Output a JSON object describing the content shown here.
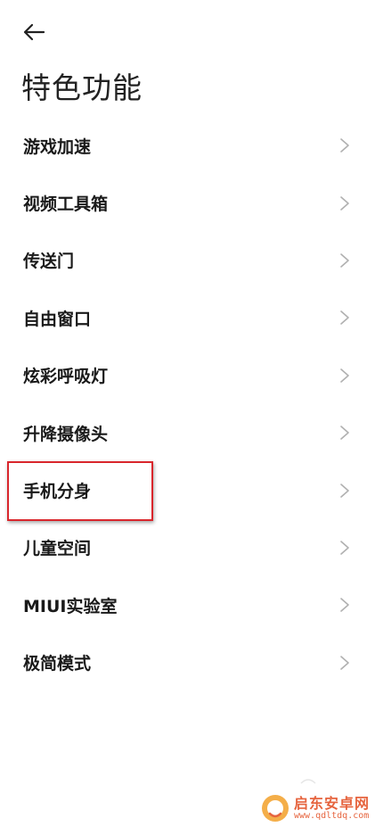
{
  "header": {
    "title": "特色功能",
    "back_icon": "arrow-left-icon"
  },
  "menu": {
    "items": [
      {
        "label": "游戏加速"
      },
      {
        "label": "视频工具箱"
      },
      {
        "label": "传送门"
      },
      {
        "label": "自由窗口"
      },
      {
        "label": "炫彩呼吸灯"
      },
      {
        "label": "升降摄像头"
      },
      {
        "label": "手机分身"
      },
      {
        "label": "儿童空间"
      },
      {
        "label": "MIUI实验室"
      },
      {
        "label": "极简模式"
      }
    ],
    "chevron_icon": "chevron-right-icon"
  },
  "annotation": {
    "highlight_color": "#d9262c",
    "highlighted_item": "手机分身"
  },
  "watermark": {
    "name": "启东安卓网",
    "url": "www.qdltdq.com",
    "color": "#e4572e"
  }
}
